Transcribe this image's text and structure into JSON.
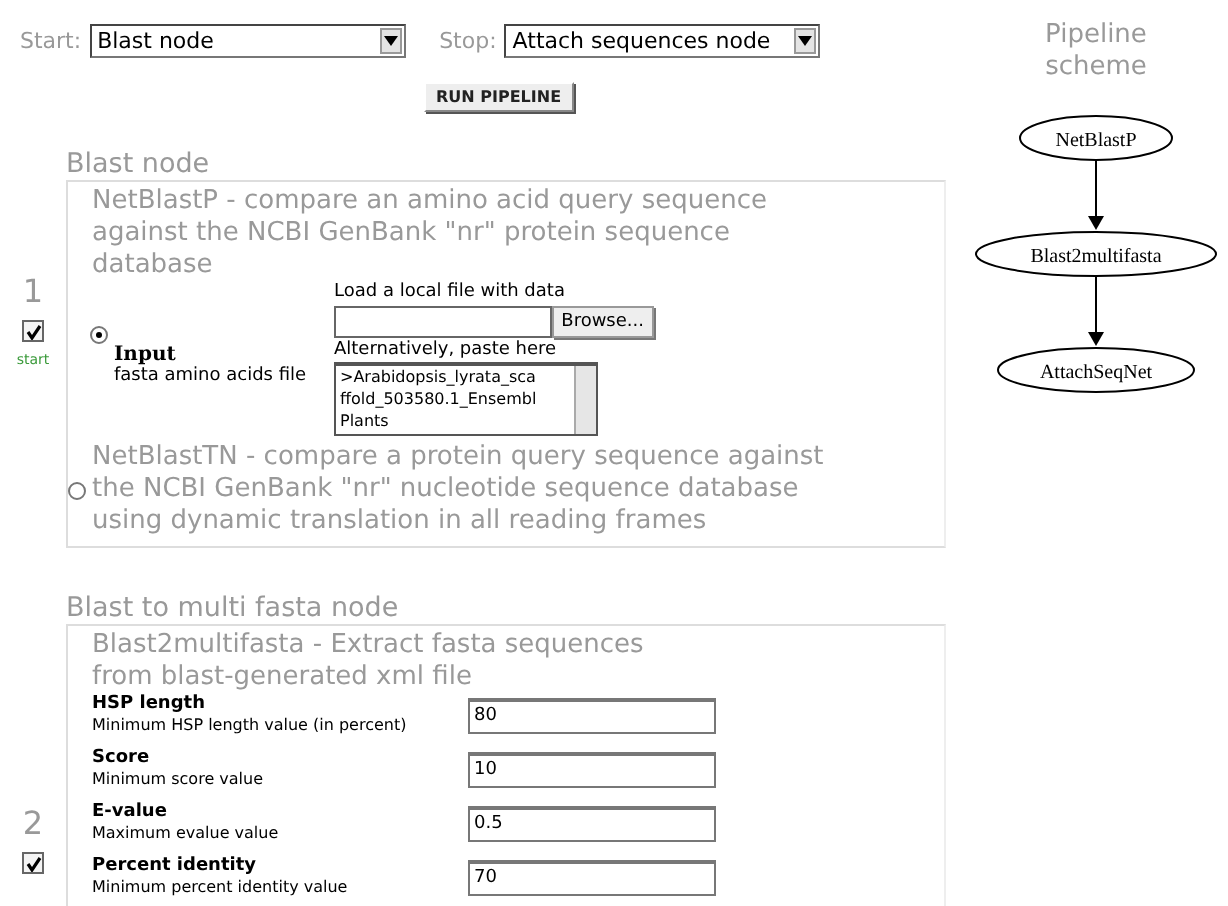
{
  "controls": {
    "start": {
      "label": "Start:",
      "value": "Blast node"
    },
    "stop": {
      "label": "Stop:",
      "value": "Attach sequences node"
    },
    "run_button": "RUN PIPELINE"
  },
  "nodes": [
    {
      "number": "1",
      "heading": "Blast node",
      "enabled": true,
      "marker": "start",
      "methods": [
        {
          "kind": "file",
          "title": "NetBlastP - compare an amino acid query sequence against the NCBI GenBank \"nr\" protein sequence database",
          "selected": true,
          "input": {
            "label": "Input",
            "description": "fasta amino acids file",
            "file_hint": "Load a local file with data",
            "browse": "Browse...",
            "paste_hint": "Alternatively, paste here",
            "paste_lines": [
              ">Arabidopsis_lyrata_sca",
              "ffold_503580.1_Ensembl",
              "Plants"
            ]
          }
        },
        {
          "kind": "plain",
          "title": "NetBlastTN - compare a protein query sequence against the NCBI GenBank \"nr\" nucleotide sequence database using dynamic translation in all reading frames",
          "selected": false
        }
      ]
    },
    {
      "number": "2",
      "heading": "Blast to multi fasta node",
      "enabled": true,
      "methods": [
        {
          "kind": "params",
          "title": "Blast2multifasta - Extract fasta sequences from blast-generated xml file",
          "params": [
            {
              "name": "HSP length",
              "description": "Minimum HSP length value (in percent)",
              "value": "80"
            },
            {
              "name": "Score",
              "description": "Minimum score value",
              "value": "10"
            },
            {
              "name": "E-value",
              "description": "Maximum evalue value",
              "value": "0.5"
            },
            {
              "name": "Percent identity",
              "description": "Minimum percent identity value",
              "value": "70"
            }
          ]
        }
      ]
    }
  ],
  "scheme": {
    "title": "Pipeline scheme",
    "steps": [
      "NetBlastP",
      "Blast2multifasta",
      "AttachSeqNet"
    ]
  }
}
